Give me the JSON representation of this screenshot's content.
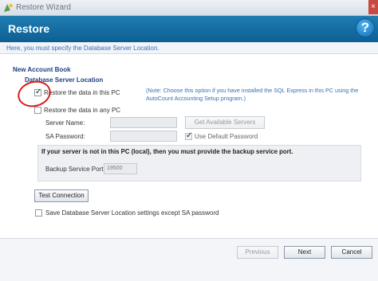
{
  "window": {
    "title": "Restore Wizard"
  },
  "banner": {
    "title": "Restore",
    "help_symbol": "?"
  },
  "subheader": {
    "text": "Here, you must specify the Database Server Location."
  },
  "section": {
    "account_book": "New Account Book",
    "server_location": "Database Server Location"
  },
  "options": {
    "restore_this_pc": {
      "label": "Restore the data in this PC",
      "checked": true
    },
    "restore_any_pc": {
      "label": "Restore the data in any PC",
      "checked": false
    }
  },
  "note": {
    "text": "(Note: Choose this option if you have installed the SQL Express in this PC using the AutoCount Accounting Setup program.)"
  },
  "fields": {
    "server_name_label": "Server Name:",
    "sa_password_label": "SA Password:",
    "get_servers_button": "Get Available Servers",
    "use_default_password_label": "Use Default Password",
    "use_default_password_checked": true
  },
  "port_panel": {
    "message": "If your server is not in this PC (local), then you must provide the backup service port.",
    "port_label": "Backup Service Port:",
    "port_value": "19500"
  },
  "actions": {
    "test_connection": "Test Connection",
    "save_location_label": "Save Database Server Location settings except SA password",
    "save_location_checked": false,
    "previous": "Previous",
    "next": "Next",
    "cancel": "Cancel"
  },
  "icons": {
    "app_icon": "wizard-icon",
    "close_icon": "close-icon",
    "help_icon": "help-icon"
  },
  "colors": {
    "banner": "#0d5f93",
    "accent_text": "#3a6fb1",
    "annotation_circle": "#d71d1d"
  }
}
